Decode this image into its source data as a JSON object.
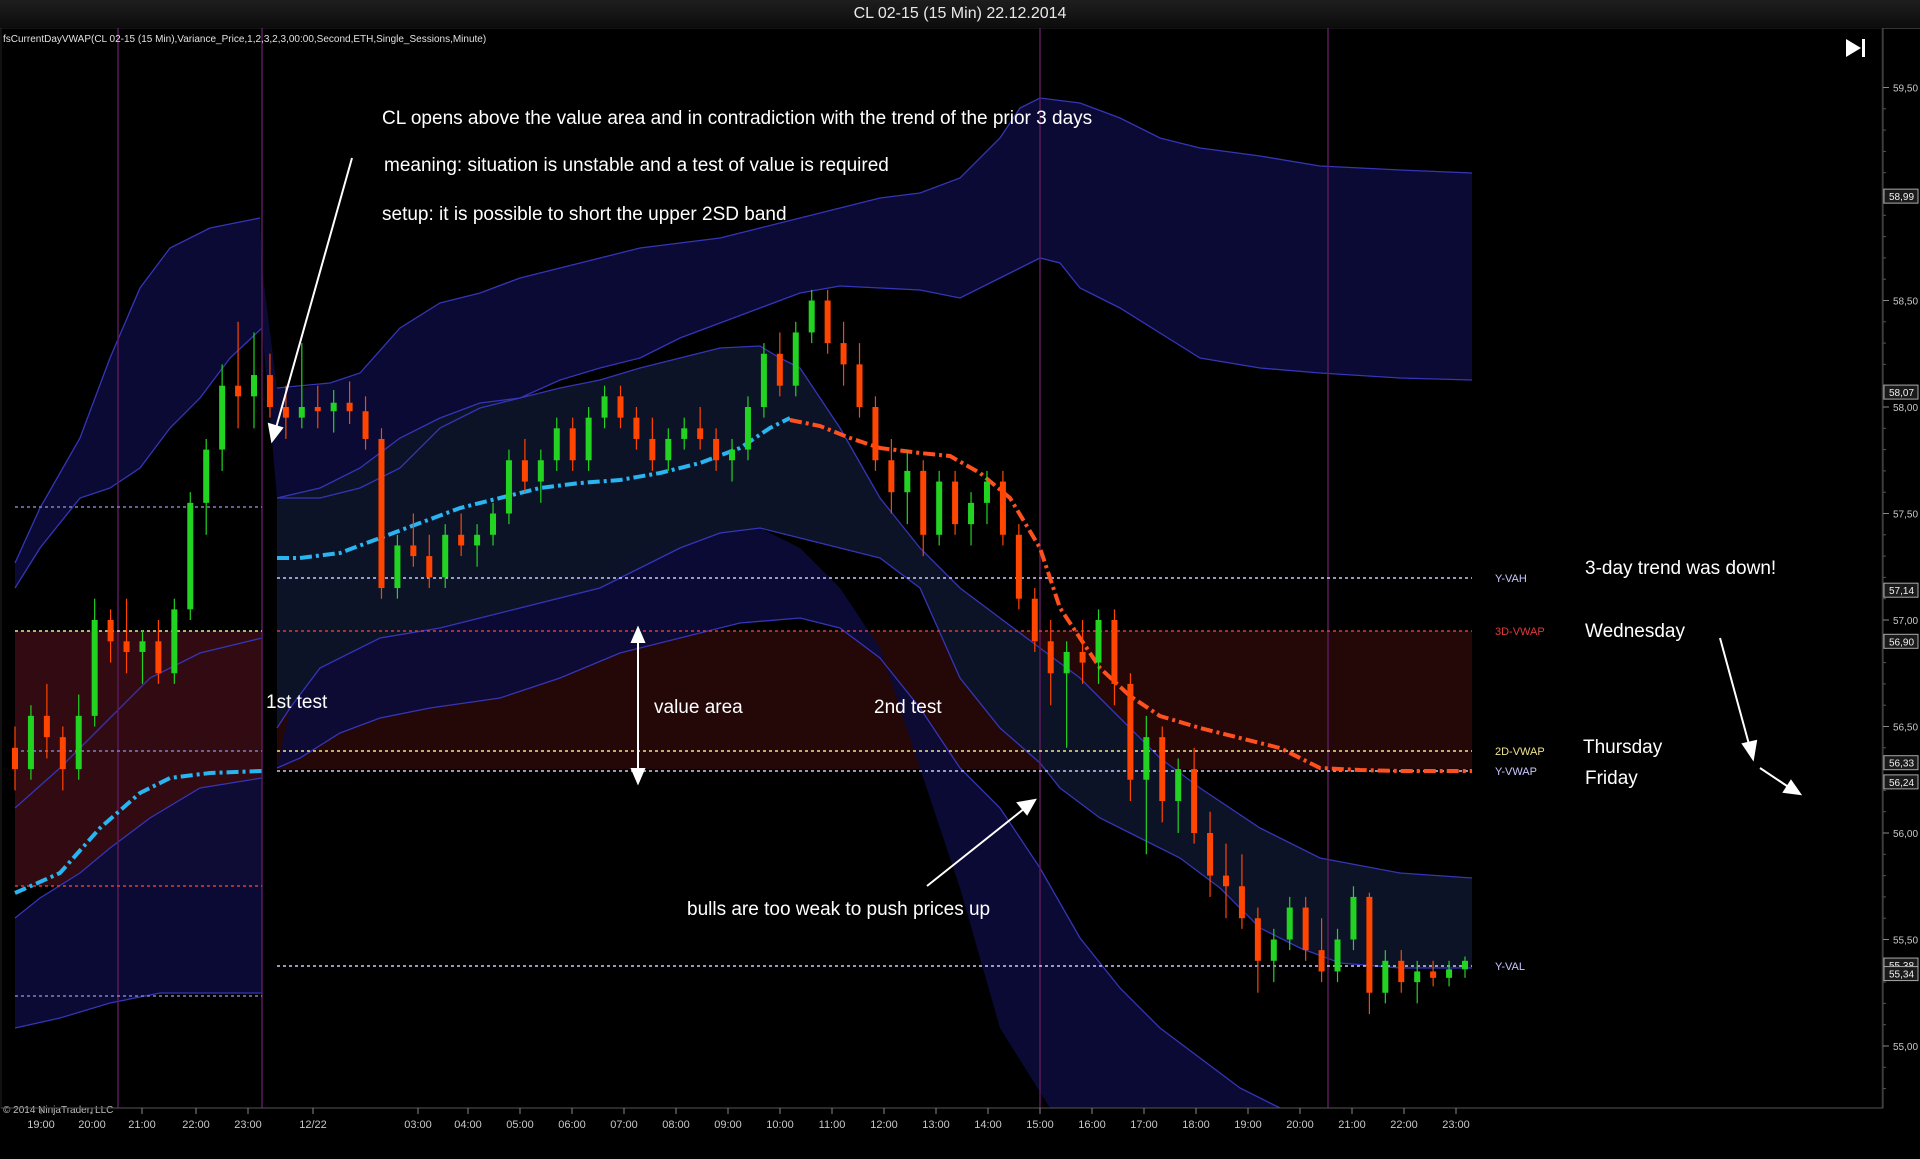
{
  "window": {
    "title": "CL 02-15 (15 Min)  22.12.2014"
  },
  "indicator_label": "fsCurrentDayVWAP(CL 02-15 (15 Min),Variance_Price,1,2,3,2,3,00:00,Second,ETH,Single_Sessions,Minute)",
  "copyright": "© 2014 NinjaTrader, LLC",
  "colors": {
    "background": "#000000",
    "bullish": "#22d322",
    "bearish": "#ff4500",
    "vwap_today": "#2ab4f0",
    "vwap_3d": "#ff5020",
    "band": "#4040c8",
    "session_line": "#5a1a5a",
    "value_area_fill": "#3a0d0d"
  },
  "annotations": {
    "open_note_1": "CL opens above the value area and in contradiction with the trend of the prior 3 days",
    "open_note_2": "meaning: situation is unstable and a test of value is required",
    "open_note_3": "setup: it is possible to short the upper 2SD band",
    "first_test": "1st test",
    "value_area": "value area",
    "second_test": "2nd test",
    "bulls_note": "bulls are too weak to push prices up",
    "trend_note": "3-day trend was down!",
    "day_wed": "Wednesday",
    "day_thu": "Thursday",
    "day_fri": "Friday"
  },
  "chart_data": {
    "type": "candlestick",
    "instrument": "CL 02-15",
    "timeframe": "15 Min",
    "ylim": [
      54.5,
      59.6
    ],
    "yticks": [
      "59,50",
      "59,00",
      "58,50",
      "58,00",
      "57,50",
      "57,00",
      "56,50",
      "56,00",
      "55,50",
      "55,00"
    ],
    "xticks": [
      "19:00",
      "20:00",
      "21:00",
      "22:00",
      "23:00",
      "12/22",
      "03:00",
      "04:00",
      "05:00",
      "06:00",
      "07:00",
      "08:00",
      "09:00",
      "10:00",
      "11:00",
      "12:00",
      "13:00",
      "14:00",
      "15:00",
      "16:00",
      "17:00",
      "18:00",
      "19:00",
      "20:00",
      "21:00",
      "22:00",
      "23:00"
    ],
    "price_markers": [
      {
        "label": "58,99",
        "value": 58.99
      },
      {
        "label": "58,07",
        "value": 58.07
      },
      {
        "label": "57,14",
        "value": 57.14
      },
      {
        "label": "56,90",
        "value": 56.9
      },
      {
        "label": "56,33",
        "value": 56.33
      },
      {
        "label": "56,24",
        "value": 56.24
      },
      {
        "label": "55,38",
        "value": 55.38
      },
      {
        "label": "55,34",
        "value": 55.34
      }
    ],
    "levels": [
      {
        "name": "Y-VAH",
        "value": 57.15,
        "color": "#c8c8ff"
      },
      {
        "name": "3D-VWAP",
        "value": 56.9,
        "color": "#e03a3a"
      },
      {
        "name": "2D-VWAP",
        "value": 56.33,
        "color": "#f0e68c"
      },
      {
        "name": "Y-VWAP",
        "value": 56.24,
        "color": "#c8c8ff"
      },
      {
        "name": "Y-VAL",
        "value": 55.35,
        "color": "#c8c8ff"
      }
    ],
    "ohlc": [
      [
        56.4,
        56.5,
        56.2,
        56.3
      ],
      [
        56.3,
        56.6,
        56.25,
        56.55
      ],
      [
        56.55,
        56.7,
        56.35,
        56.45
      ],
      [
        56.45,
        56.5,
        56.2,
        56.3
      ],
      [
        56.3,
        56.65,
        56.25,
        56.55
      ],
      [
        56.55,
        57.1,
        56.5,
        57.0
      ],
      [
        57.0,
        57.05,
        56.8,
        56.9
      ],
      [
        56.9,
        57.1,
        56.75,
        56.85
      ],
      [
        56.85,
        56.95,
        56.7,
        56.9
      ],
      [
        56.9,
        57.0,
        56.7,
        56.75
      ],
      [
        56.75,
        57.1,
        56.7,
        57.05
      ],
      [
        57.05,
        57.6,
        57.0,
        57.55
      ],
      [
        57.55,
        57.85,
        57.4,
        57.8
      ],
      [
        57.8,
        58.2,
        57.7,
        58.1
      ],
      [
        58.1,
        58.4,
        57.9,
        58.05
      ],
      [
        58.05,
        58.35,
        57.9,
        58.15
      ],
      [
        58.15,
        58.25,
        57.95,
        58.0
      ],
      [
        58.0,
        58.1,
        57.85,
        57.95
      ],
      [
        57.95,
        58.3,
        57.9,
        58.0
      ],
      [
        58.0,
        58.1,
        57.9,
        57.98
      ],
      [
        57.98,
        58.08,
        57.88,
        58.02
      ],
      [
        58.02,
        58.12,
        57.92,
        57.98
      ],
      [
        57.98,
        58.05,
        57.8,
        57.85
      ],
      [
        57.85,
        57.9,
        57.1,
        57.15
      ],
      [
        57.15,
        57.4,
        57.1,
        57.35
      ],
      [
        57.35,
        57.5,
        57.25,
        57.3
      ],
      [
        57.3,
        57.4,
        57.15,
        57.2
      ],
      [
        57.2,
        57.45,
        57.15,
        57.4
      ],
      [
        57.4,
        57.5,
        57.3,
        57.35
      ],
      [
        57.35,
        57.45,
        57.25,
        57.4
      ],
      [
        57.4,
        57.55,
        57.35,
        57.5
      ],
      [
        57.5,
        57.8,
        57.45,
        57.75
      ],
      [
        57.75,
        57.85,
        57.6,
        57.65
      ],
      [
        57.65,
        57.8,
        57.55,
        57.75
      ],
      [
        57.75,
        57.95,
        57.7,
        57.9
      ],
      [
        57.9,
        57.95,
        57.7,
        57.75
      ],
      [
        57.75,
        58.0,
        57.7,
        57.95
      ],
      [
        57.95,
        58.1,
        57.9,
        58.05
      ],
      [
        58.05,
        58.1,
        57.9,
        57.95
      ],
      [
        57.95,
        58.0,
        57.8,
        57.85
      ],
      [
        57.85,
        57.95,
        57.7,
        57.75
      ],
      [
        57.75,
        57.9,
        57.7,
        57.85
      ],
      [
        57.85,
        57.95,
        57.8,
        57.9
      ],
      [
        57.9,
        58.0,
        57.8,
        57.85
      ],
      [
        57.85,
        57.9,
        57.7,
        57.75
      ],
      [
        57.75,
        57.85,
        57.65,
        57.8
      ],
      [
        57.8,
        58.05,
        57.75,
        58.0
      ],
      [
        58.0,
        58.3,
        57.95,
        58.25
      ],
      [
        58.25,
        58.35,
        58.05,
        58.1
      ],
      [
        58.1,
        58.4,
        58.05,
        58.35
      ],
      [
        58.35,
        58.55,
        58.3,
        58.5
      ],
      [
        58.5,
        58.55,
        58.25,
        58.3
      ],
      [
        58.3,
        58.4,
        58.1,
        58.2
      ],
      [
        58.2,
        58.3,
        57.95,
        58.0
      ],
      [
        58.0,
        58.05,
        57.7,
        57.75
      ],
      [
        57.75,
        57.85,
        57.5,
        57.6
      ],
      [
        57.6,
        57.8,
        57.45,
        57.7
      ],
      [
        57.7,
        57.75,
        57.3,
        57.4
      ],
      [
        57.4,
        57.7,
        57.35,
        57.65
      ],
      [
        57.65,
        57.7,
        57.4,
        57.45
      ],
      [
        57.45,
        57.6,
        57.35,
        57.55
      ],
      [
        57.55,
        57.7,
        57.45,
        57.65
      ],
      [
        57.65,
        57.7,
        57.35,
        57.4
      ],
      [
        57.4,
        57.45,
        57.05,
        57.1
      ],
      [
        57.1,
        57.15,
        56.85,
        56.9
      ],
      [
        56.9,
        57.0,
        56.6,
        56.75
      ],
      [
        56.75,
        56.9,
        56.4,
        56.85
      ],
      [
        56.85,
        57.0,
        56.7,
        56.8
      ],
      [
        56.8,
        57.05,
        56.7,
        57.0
      ],
      [
        57.0,
        57.05,
        56.6,
        56.7
      ],
      [
        56.7,
        56.75,
        56.15,
        56.25
      ],
      [
        56.25,
        56.55,
        55.9,
        56.45
      ],
      [
        56.45,
        56.5,
        56.05,
        56.15
      ],
      [
        56.15,
        56.35,
        56.0,
        56.3
      ],
      [
        56.3,
        56.4,
        55.95,
        56.0
      ],
      [
        56.0,
        56.1,
        55.7,
        55.8
      ],
      [
        55.8,
        55.95,
        55.6,
        55.75
      ],
      [
        55.75,
        55.9,
        55.55,
        55.6
      ],
      [
        55.6,
        55.65,
        55.25,
        55.4
      ],
      [
        55.4,
        55.55,
        55.3,
        55.5
      ],
      [
        55.5,
        55.7,
        55.45,
        55.65
      ],
      [
        55.65,
        55.7,
        55.4,
        55.45
      ],
      [
        55.45,
        55.6,
        55.3,
        55.35
      ],
      [
        55.35,
        55.55,
        55.3,
        55.5
      ],
      [
        55.5,
        55.75,
        55.45,
        55.7
      ],
      [
        55.7,
        55.72,
        55.15,
        55.25
      ],
      [
        55.25,
        55.45,
        55.2,
        55.4
      ],
      [
        55.4,
        55.45,
        55.25,
        55.3
      ],
      [
        55.3,
        55.4,
        55.2,
        55.35
      ],
      [
        55.35,
        55.4,
        55.28,
        55.32
      ],
      [
        55.32,
        55.4,
        55.28,
        55.36
      ],
      [
        55.36,
        55.42,
        55.32,
        55.4
      ]
    ]
  }
}
